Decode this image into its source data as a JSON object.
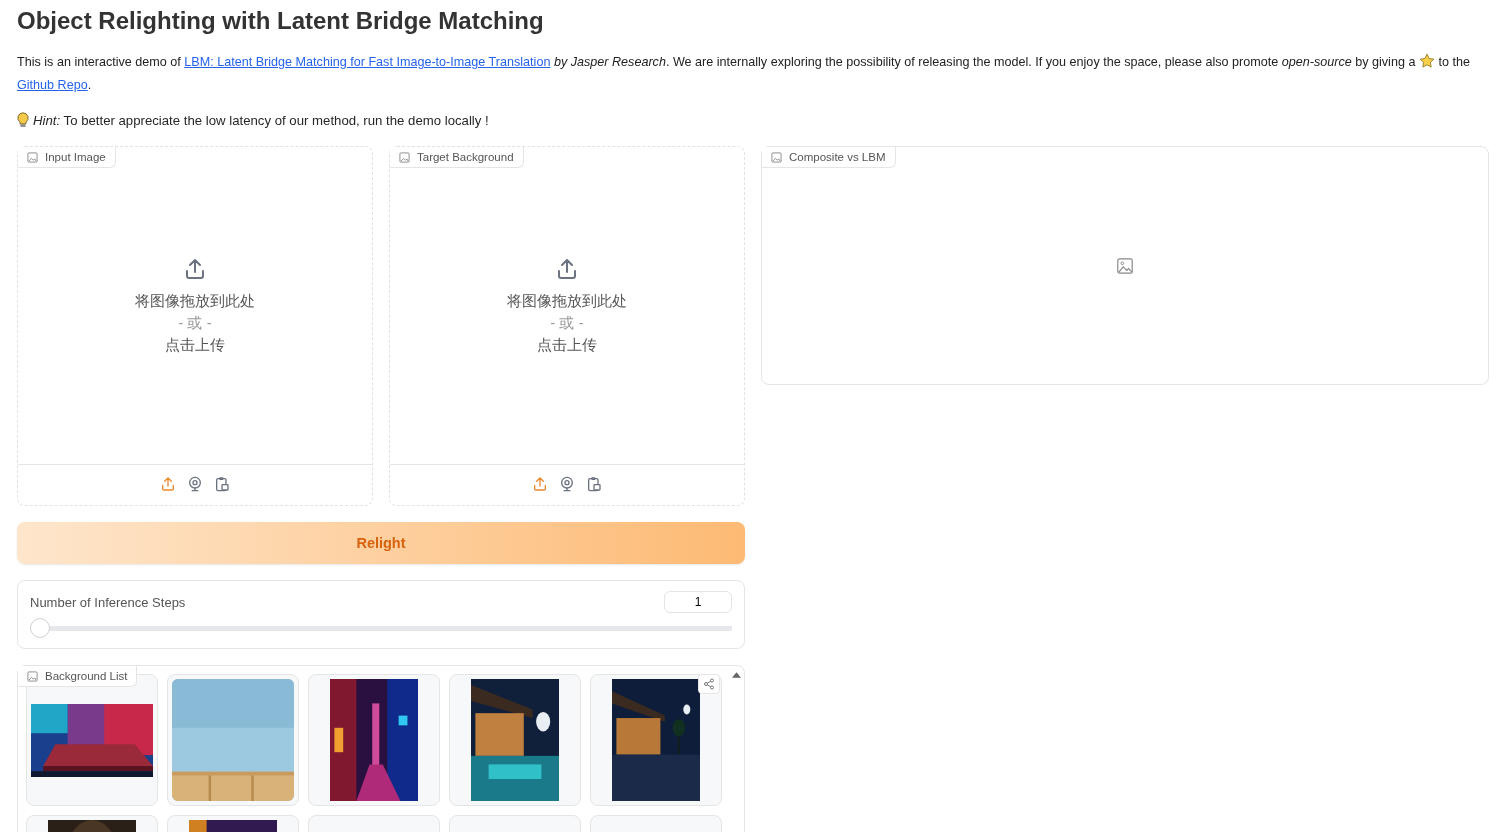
{
  "title": "Object Relighting with Latent Bridge Matching",
  "intro": [
    {
      "kind": "text",
      "text": "This is an interactive demo of "
    },
    {
      "kind": "link",
      "text": "LBM: Latent Bridge Matching for Fast Image-to-Image Translation"
    },
    {
      "kind": "italic",
      "text": " by Jasper Research"
    },
    {
      "kind": "text",
      "text": ". We are internally exploring the possibility of releasing the model. If you enjoy the space, please also promote "
    },
    {
      "kind": "italic",
      "text": "open-source"
    },
    {
      "kind": "text",
      "text": " by giving a "
    },
    {
      "kind": "star"
    },
    {
      "kind": "text",
      "text": " to the "
    },
    {
      "kind": "link",
      "text": "Github Repo"
    },
    {
      "kind": "text",
      "text": "."
    }
  ],
  "hint": {
    "label": "Hint:",
    "text": " To better appreciate the low latency of our method, run the demo locally !"
  },
  "inputs": [
    {
      "label": "Input Image",
      "drop_text": "将图像拖放到此处",
      "or_text": "- 或 -",
      "click_text": "点击上传",
      "sources": [
        {
          "kind": "upload",
          "selected": true
        },
        {
          "kind": "webcam",
          "selected": false
        },
        {
          "kind": "clipboard",
          "selected": false
        }
      ]
    },
    {
      "label": "Target Background",
      "drop_text": "将图像拖放到此处",
      "or_text": "- 或 -",
      "click_text": "点击上传",
      "sources": [
        {
          "kind": "upload",
          "selected": true
        },
        {
          "kind": "webcam",
          "selected": false
        },
        {
          "kind": "clipboard",
          "selected": false
        }
      ]
    }
  ],
  "relight_button": "Relight",
  "slider": {
    "label": "Number of Inference Steps",
    "value": "1",
    "level": 0
  },
  "gallery": {
    "label": "Background List",
    "items": [
      {
        "kind": "picture"
      },
      {
        "kind": "picture"
      },
      {
        "kind": "picture"
      },
      {
        "kind": "picture"
      },
      {
        "kind": "picture"
      },
      {
        "kind": "picture"
      },
      {
        "kind": "picture"
      },
      {
        "kind": "empty"
      },
      {
        "kind": "empty"
      },
      {
        "kind": "empty"
      }
    ]
  },
  "output": {
    "label": "Composite vs LBM"
  }
}
